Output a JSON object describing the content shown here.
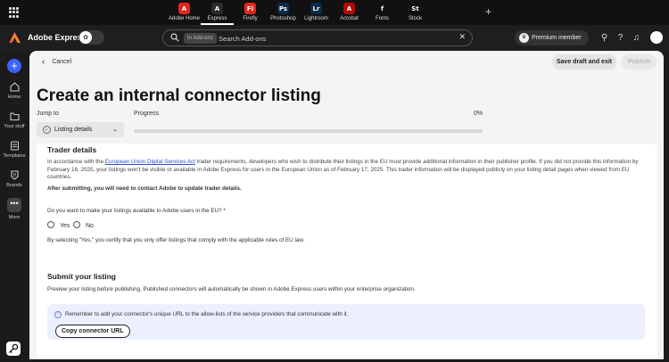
{
  "apps": [
    {
      "label": "Adobe Home",
      "icon": "adobe-home-icon",
      "color": "#e1251b",
      "glyph": "A"
    },
    {
      "label": "Express",
      "icon": "express-icon",
      "color": "#2b2b2b",
      "glyph": "A",
      "active": true
    },
    {
      "label": "Firefly",
      "icon": "firefly-icon",
      "color": "#e1251b",
      "glyph": "Fi"
    },
    {
      "label": "Photoshop",
      "icon": "photoshop-icon",
      "color": "#0d2a4a",
      "glyph": "Ps"
    },
    {
      "label": "Lightroom",
      "icon": "lightroom-icon",
      "color": "#0d2a4a",
      "glyph": "Lr"
    },
    {
      "label": "Acrobat",
      "icon": "acrobat-icon",
      "color": "#b30b00",
      "glyph": "A"
    },
    {
      "label": "Fonts",
      "icon": "fonts-icon",
      "color": "#111111",
      "glyph": "f"
    },
    {
      "label": "Stock",
      "icon": "stock-icon",
      "color": "#111111",
      "glyph": "St"
    }
  ],
  "header": {
    "brand": "Adobe Express",
    "search_chip": "In Add-ons",
    "search_placeholder": "Search Add-ons",
    "premium_label": "Premium member"
  },
  "rail": {
    "items": [
      {
        "label": "Home",
        "icon": "home-icon"
      },
      {
        "label": "Your stuff",
        "icon": "folder-icon"
      },
      {
        "label": "Templates",
        "icon": "templates-icon"
      },
      {
        "label": "Brands",
        "icon": "brands-icon"
      },
      {
        "label": "More",
        "icon": "more-icon"
      }
    ]
  },
  "page": {
    "cancel_label": "Cancel",
    "save_label": "Save draft and exit",
    "publish_label": "Publish",
    "title": "Create an internal connector listing",
    "jump_to_label": "Jump to",
    "jump_to_value": "Listing details",
    "progress_label": "Progress",
    "progress_value": "0%",
    "progress_fraction": 0
  },
  "trader": {
    "heading": "Trader details",
    "para_prefix": "In accordance with the ",
    "link_text": "European Union Digital Services Act",
    "para_rest": " trader requirements, developers who wish to distribute their listings in the EU must provide additional information in their publisher profile. If you did not provide this information by February 16, 2025, your listings won't be visible or available in Adobe Express for users in the European Union as of February 17, 2025. This trader information will be displayed publicly on your listing detail pages when viewed from EU countries.",
    "after_submit": "After submitting, you will need to contact Adobe to update trader details.",
    "question": "Do you want to make your listings available to Adobe users in the EU?",
    "required_mark": "*",
    "yes_label": "Yes",
    "no_label": "No",
    "certify_text": "By selecting \"Yes,\" you certify that you only offer listings that comply with the applicable rules of EU law."
  },
  "submit": {
    "heading": "Submit your listing",
    "description": "Preview your listing before publishing. Published connectors will automatically be shown in Adobe Express users within your enterprise organization.",
    "info_text": "Remember to add your connector's unique URL to the allow-lists of the service providers that communicate with it.",
    "copy_button": "Copy connector URL"
  },
  "colors": {
    "accent": "#3b63fb",
    "link": "#2a55d8",
    "info_bg": "#eceffd"
  }
}
